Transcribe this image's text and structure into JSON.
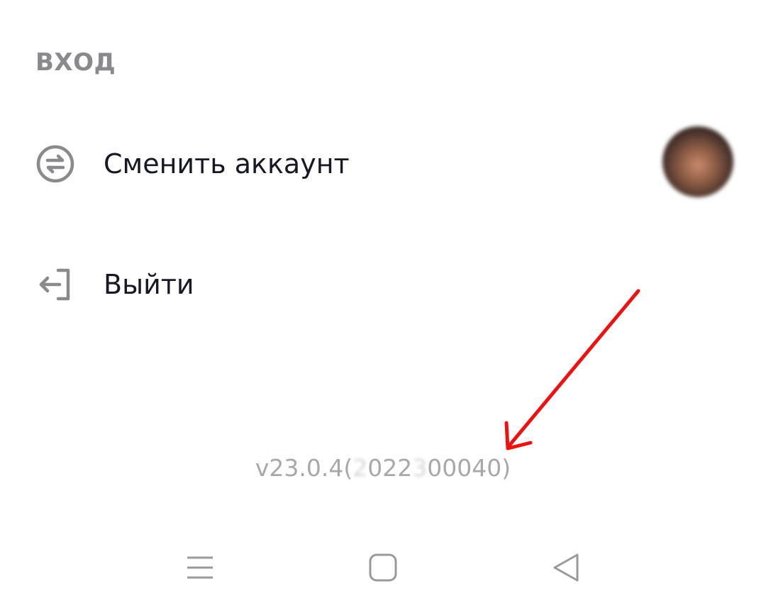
{
  "section": {
    "title": "ВХОД"
  },
  "menu": {
    "switch_account": {
      "label": "Сменить аккаунт",
      "icon": "switch-account-icon"
    },
    "logout": {
      "label": "Выйти",
      "icon": "logout-icon"
    }
  },
  "version": {
    "prefix": "v23.0.4(",
    "blur1": "2",
    "mid": "022",
    "blur2": "3",
    "suffix": "00040)"
  },
  "annotation": {
    "color": "#ee1111",
    "icon": "red-arrow-annotation"
  },
  "navbar": {
    "icons": [
      "menu-icon",
      "home-icon",
      "back-icon"
    ]
  },
  "colors": {
    "text_primary": "#161823",
    "text_secondary": "#8a8a8e",
    "icon_gray": "#8a8a8e"
  }
}
